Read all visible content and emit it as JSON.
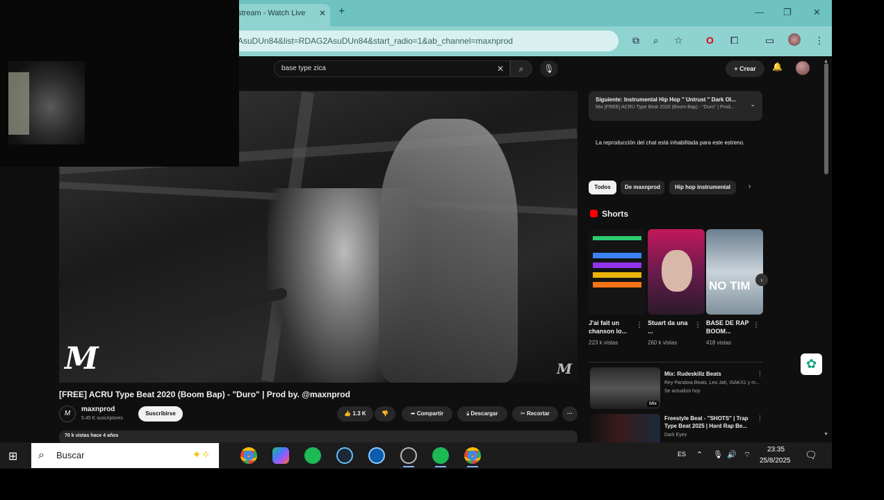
{
  "browser": {
    "tab_title": "stream - Watch Live",
    "tab_close": "✕",
    "new_tab": "+",
    "url": "AsuDUn84&list=RDAG2AsuDUn84&start_radio=1&ab_channel=maxnprod",
    "window_controls": {
      "minimize": "—",
      "restore": "❐",
      "close": "✕"
    }
  },
  "youtube": {
    "search_query": "base type zica",
    "create_label": "+ Crear",
    "video": {
      "title": "[FREE] ACRU Type Beat 2020 (Boom Bap) - \"Duro\" | Prod by. @maxnprod",
      "channel_name": "maxnprod",
      "channel_subs": "5.45 K suscriptores",
      "subscribe_label": "Suscribirse",
      "likes": "1.3 K",
      "share_label": "Compartir",
      "download_label": "Descargar",
      "clip_label": "Recortar",
      "more": "···",
      "description_meta": "70 k vistas  hace 4 años",
      "watermark": "M"
    },
    "up_next": {
      "title": "Siguiente: Instrumental Hip Hop \" Untrust \" Dark Ol...",
      "subtitle": "Mix [FREE] ACRU Type Beat 2020 (Boom Bap) - \"Duro\" | Prod...",
      "chevron": "⌄"
    },
    "chat_disabled": "La reproducción del chat está inhabilitada para este estreno.",
    "chips": [
      "Todos",
      "De maxnprod",
      "Hip hop instrumental"
    ],
    "chip_next": "›",
    "shorts_label": "Shorts",
    "shorts_next": "›",
    "shorts": [
      {
        "title": "J'ai fait un chanson lo...",
        "views": "223 k vistas"
      },
      {
        "title": "Stuart da una ...",
        "views": "260 k vistas"
      },
      {
        "title": "BASE DE RAP BOOM...",
        "views": "418 vistas",
        "thumb_text": "NO TIM"
      }
    ],
    "recommended": [
      {
        "title": "Mix: Rudeskillz Beats",
        "meta1": "Rey Pandora Beats, Leo Jah, ISAKX1 y m...",
        "meta2": "Se actualizó hoy",
        "badge": "Mix"
      },
      {
        "title": "Freestyle Beat - \"SHOTS\" | Trap Type Beat 2025 | Hard Rap Be...",
        "meta1": "Dark Eyez",
        "meta2": ""
      }
    ]
  },
  "taskbar": {
    "search_placeholder": "Buscar",
    "lang": "ES",
    "time": "23:35",
    "date": "25/8/2025"
  },
  "colors": {
    "tab_bar": "#6ec3c1",
    "toolbar": "#8fd3d1",
    "youtube_bg": "#0f0f0f",
    "youtube_red": "#ff0000",
    "chip_active": "#f1f1f1"
  }
}
